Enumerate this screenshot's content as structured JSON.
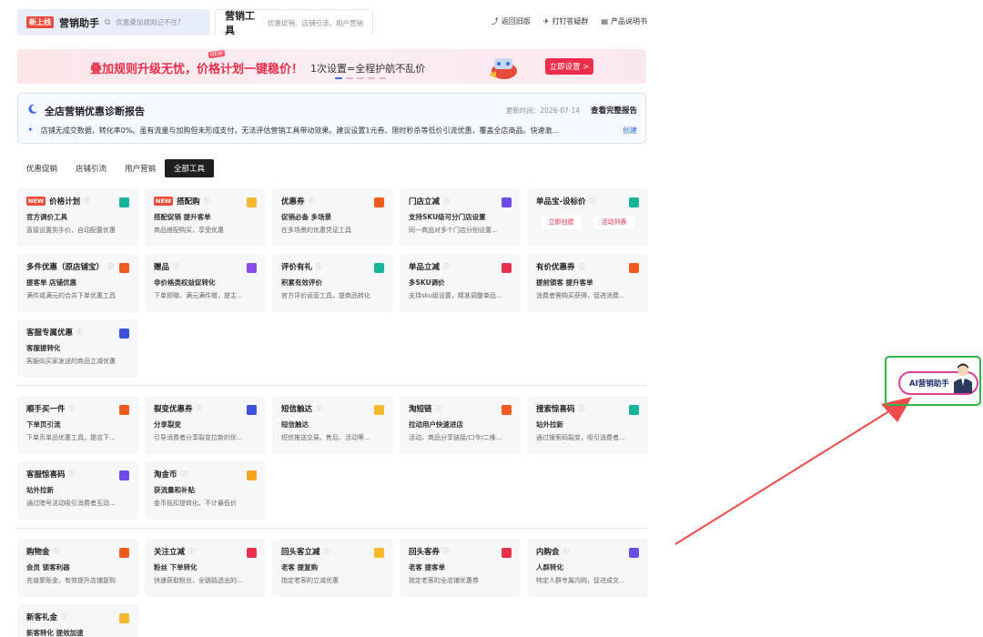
{
  "header": {
    "tab1": {
      "badge": "新上线",
      "title": "营销助手",
      "subtitle": "优惠叠加规则记不住?"
    },
    "tab2": {
      "title": "营销工具",
      "subtitle": "优惠促销、店铺引流、用户营销"
    },
    "links": [
      {
        "icon": "return-icon",
        "label": "返回旧版"
      },
      {
        "icon": "feedback-icon",
        "label": "打钉答疑群"
      },
      {
        "icon": "manual-icon",
        "label": "产品说明书"
      }
    ]
  },
  "banner": {
    "title": "叠加规则升级无忧，价格计划一键稳价！",
    "subtitle": "1次设置=全程护航不乱价",
    "new_tag": "NEW",
    "button": "立即设置 >"
  },
  "report": {
    "title": "全店营销优惠诊断报告",
    "time": "更新时间：2026-07-14",
    "link": "查看完整报告",
    "body": "店铺无成交数据，转化率0%。虽有流量与加购但未形成支付，无法评估营销工具带动效果。建议设置1元券、限时秒杀等低价引流优惠，覆盖全店商品。快速激...",
    "more": "创建"
  },
  "categories": [
    "优惠促销",
    "店铺引流",
    "用户营销",
    "全部工具"
  ],
  "cards_a": [
    {
      "new": "NEW",
      "name": "价格计划",
      "tag": "官方调价工具",
      "desc": "直接设置到手价，自动配置优惠",
      "color": "#17b49a"
    },
    {
      "new": "NEW",
      "name": "搭配购",
      "tag": "搭配促销  提升客单",
      "desc": "商品搭配购买，享受优惠",
      "color": "#f5b82e"
    },
    {
      "name": "优惠券",
      "tag": "促销必备  多场景",
      "desc": "在多场景的优惠凭证工具",
      "color": "#f25a1f"
    },
    {
      "name": "门店立减",
      "tag": "支持SKU级可分门店设置",
      "desc": "同一商品对多个门店分别设置...",
      "color": "#6b4ce6"
    },
    {
      "name": "单品宝-设标价",
      "tag": "",
      "desc": "",
      "btn1": "立即创建",
      "btn2": "活动列表",
      "color": "#17b49a"
    },
    {
      "name": "多件优惠（原店铺宝）",
      "tag": "提客单  店铺优惠",
      "desc": "满件或满元的合并下单优惠工具",
      "color": "#f25a1f"
    },
    {
      "name": "赠品",
      "tag": "非价格类权益促转化",
      "desc": "下单即赠、满元满件赠，提主...",
      "color": "#8a4de8"
    },
    {
      "name": "评价有礼",
      "tag": "积累有效评价",
      "desc": "官方评价运营工具，提商品转化",
      "color": "#17b49a"
    },
    {
      "name": "单品立减",
      "tag": "多SKU调价",
      "desc": "支持sku级设置，精准调整单品...",
      "color": "#e8304d"
    },
    {
      "name": "有价优惠券",
      "tag": "提前锁客  提升客单",
      "desc": "消费者需购买获得，促进消费...",
      "color": "#f25a1f"
    },
    {
      "name": "客服专属优惠",
      "tag": "客服提转化",
      "desc": "客服向买家发送的商品立减优惠",
      "color": "#3b52d9"
    }
  ],
  "cards_b": [
    {
      "name": "顺手买一件",
      "tag": "下单页引流",
      "desc": "下单页单品优惠工具，提店下...",
      "color": "#f25a1f"
    },
    {
      "name": "裂变优惠券",
      "tag": "分享裂变",
      "desc": "引导消费者分享裂变拉新的优...",
      "color": "#3b52d9"
    },
    {
      "name": "短信触达",
      "tag": "短信触达",
      "desc": "短信推送交易、售后、活动等...",
      "color": "#f5b82e"
    },
    {
      "name": "淘短链",
      "tag": "拉动用户快速进店",
      "desc": "活动、商品分享链接/口令/二维...",
      "color": "#f25a1f"
    },
    {
      "name": "搜索惊喜码",
      "tag": "站外拉新",
      "desc": "通过搜索码裂变，吸引消费者...",
      "color": "#17b49a"
    },
    {
      "name": "客服惊喜码",
      "tag": "站外拉新",
      "desc": "通过暗号活动吸引消费者互动...",
      "color": "#6b4ce6"
    },
    {
      "name": "淘金币",
      "tag": "获流量和补贴",
      "desc": "金币抵扣提转化、不计最低价",
      "color": "#f5a623"
    }
  ],
  "cards_c": [
    {
      "name": "购物金",
      "tag": "会员  锁客利器",
      "desc": "充值聚账金，有效提升店铺复购",
      "color": "#f25a1f"
    },
    {
      "name": "关注立减",
      "tag": "粉丝  下单转化",
      "desc": "快速获取粉丝，全链路透出的...",
      "color": "#e8304d"
    },
    {
      "name": "回头客立减",
      "tag": "老客  提复购",
      "desc": "指定老客的立减优惠",
      "color": "#f5b82e"
    },
    {
      "name": "回头客券",
      "tag": "老客  提客单",
      "desc": "指定老客的全店铺优惠券",
      "color": "#e8304d"
    },
    {
      "name": "内购会",
      "tag": "人群转化",
      "desc": "特定人群专属内购，促进成交...",
      "color": "#6b4ce6"
    },
    {
      "name": "新客礼金",
      "tag": "新客转化  提效加速",
      "desc": "",
      "color": "#f5b82e"
    }
  ],
  "ai_assistant": {
    "label": "AI营销助手"
  },
  "colors": {
    "accent": "#e8304d",
    "brand_blue": "#3b6bf5",
    "highlight_green": "#2fb34a",
    "arrow_red": "#f04a4a"
  }
}
